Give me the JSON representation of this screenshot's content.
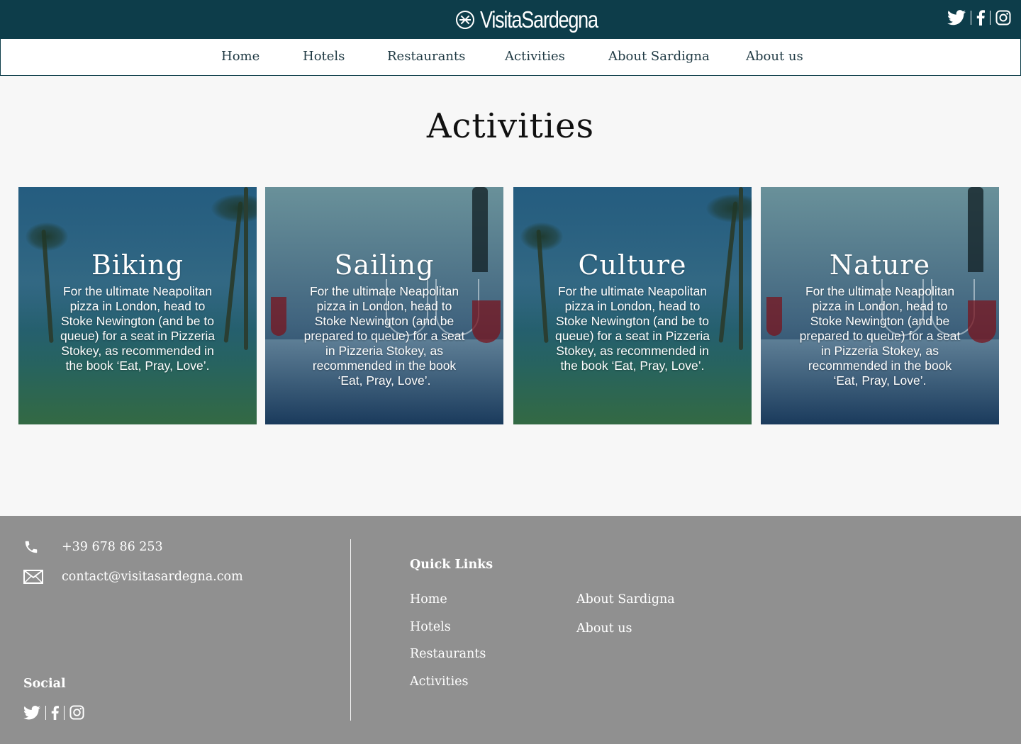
{
  "brand": {
    "name": "VisitaSardegna"
  },
  "colors": {
    "header_bg": "#0d3d4a",
    "footer_bg": "#909090",
    "page_bg": "#f7f7f7",
    "text_on_dark": "#ffffff"
  },
  "header": {
    "social_icons": [
      "twitter-icon",
      "facebook-icon",
      "instagram-icon"
    ]
  },
  "nav": {
    "items": [
      {
        "label": "Home"
      },
      {
        "label": "Hotels"
      },
      {
        "label": "Restaurants"
      },
      {
        "label": "Activities"
      },
      {
        "label": "About Sardigna"
      },
      {
        "label": "About us"
      }
    ]
  },
  "page": {
    "title": "Activities"
  },
  "cards": [
    {
      "title": "Biking",
      "text": "For the ultimate Neapolitan pizza in London, head to Stoke Newington (and be to queue) for a seat in Pizzeria Stokey, as recommended in the book ‘Eat, Pray, Love’."
    },
    {
      "title": "Sailing",
      "text": "For the ultimate Neapolitan pizza in London, head to Stoke Newington (and be prepared to queue) for a seat in Pizzeria Stokey, as recommended in the book ‘Eat, Pray, Love’."
    },
    {
      "title": "Culture",
      "text": "For the ultimate Neapolitan pizza in London, head to Stoke Newington (and be to queue) for a seat in Pizzeria Stokey, as recommended in the book ‘Eat, Pray, Love’."
    },
    {
      "title": "Nature",
      "text": "For the ultimate Neapolitan pizza in London, head to Stoke Newington (and be prepared to queue) for a seat in Pizzeria Stokey, as recommended in the book ‘Eat, Pray, Love’."
    }
  ],
  "footer": {
    "phone": {
      "icon": "phone-icon",
      "value": "+39 678 86 253"
    },
    "email": {
      "icon": "mail-icon",
      "value": "contact@visitasardegna.com"
    },
    "social_title": "Social",
    "quick_links_title": "Quick Links",
    "quick_links": [
      {
        "label": "Home"
      },
      {
        "label": "Hotels"
      },
      {
        "label": "Restaurants"
      },
      {
        "label": "Activities"
      },
      {
        "label": "About Sardigna"
      },
      {
        "label": "About us"
      }
    ]
  }
}
